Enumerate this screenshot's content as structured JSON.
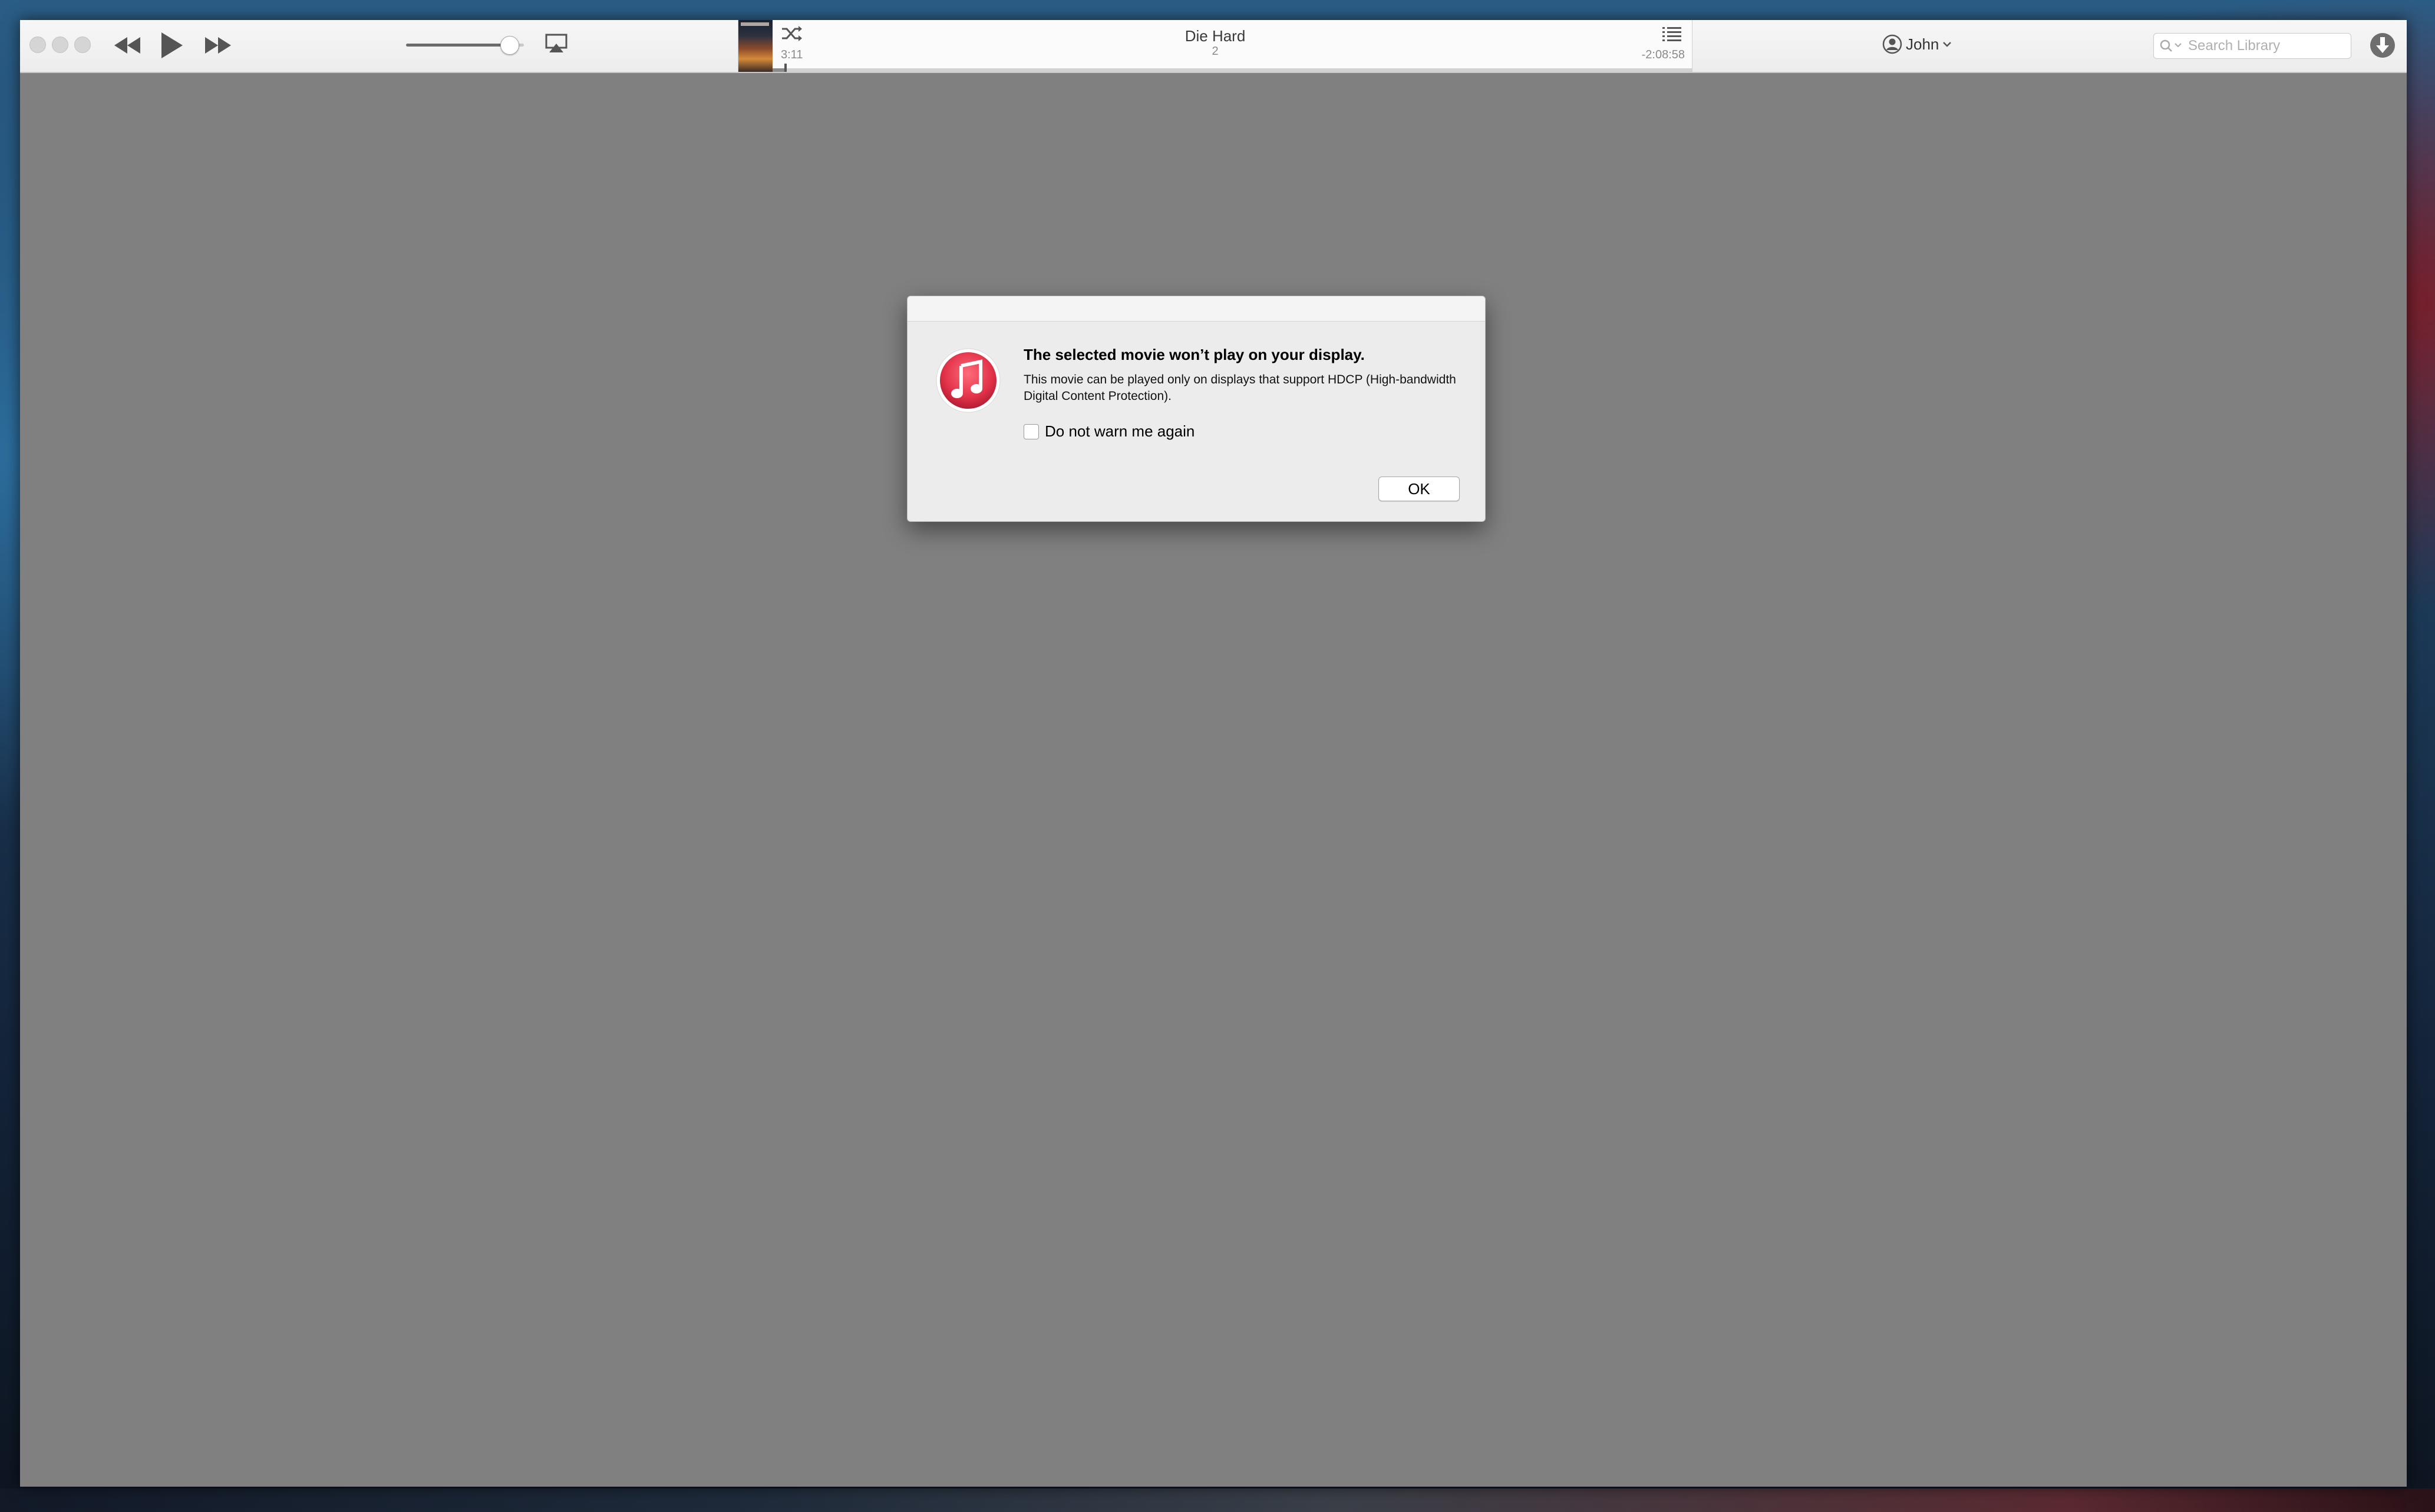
{
  "now_playing": {
    "title": "Die Hard",
    "subtitle": "2",
    "elapsed": "3:11",
    "remaining": "-2:08:58",
    "progress_fraction": 0.013
  },
  "volume": {
    "level_fraction": 0.85
  },
  "account": {
    "user_name": "John"
  },
  "search": {
    "placeholder": "Search Library"
  },
  "dialog": {
    "title": "The selected movie won’t play on your display.",
    "body": "This movie can be played only on displays that support HDCP (High-bandwidth Digital Content Protection).",
    "checkbox_label": "Do not warn me again",
    "checkbox_checked": false,
    "ok_label": "OK"
  },
  "icons": {
    "traffic_lights": [
      "close-icon",
      "minimize-icon",
      "zoom-icon"
    ],
    "controls": [
      "rewind-icon",
      "play-icon",
      "fast-forward-icon"
    ],
    "airplay": "airplay-icon",
    "shuffle": "shuffle-icon",
    "up_next": "up-next-list-icon",
    "user": "user-icon",
    "search": "search-icon",
    "download": "download-icon",
    "app": "itunes-music-note-icon"
  },
  "colors": {
    "itunes_red": "#e2324a",
    "content_gray": "#808080"
  }
}
